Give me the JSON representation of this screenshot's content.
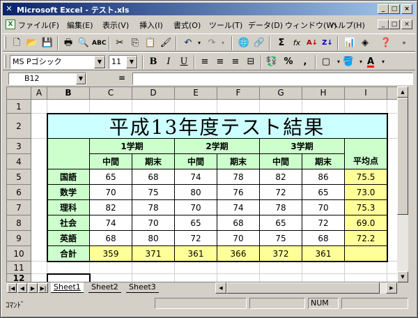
{
  "window": {
    "title": "Microsoft Excel - テスト.xls",
    "app_icon": "excel-icon",
    "controls": {
      "minimize": "_",
      "maximize": "□",
      "close": "×"
    }
  },
  "menu": {
    "items": [
      "ファイル(F)",
      "編集(E)",
      "表示(V)",
      "挿入(I)",
      "書式(O)",
      "ツール(T)",
      "データ(D)",
      "ウィンドウ(W)",
      "ヘルプ(H)"
    ]
  },
  "toolbar_standard": {
    "icons": [
      "new-icon",
      "open-icon",
      "save-icon",
      "print-icon",
      "print-preview-icon",
      "spellcheck-icon",
      "cut-icon",
      "copy-icon",
      "paste-icon",
      "format-painter-icon",
      "undo-icon",
      "redo-icon",
      "hyperlink-icon",
      "web-icon",
      "autosum-icon",
      "function-icon",
      "sort-asc-icon",
      "sort-desc-icon",
      "chart-wizard-icon",
      "drawing-icon",
      "help-icon"
    ],
    "glyphs": {
      "autosum": "Σ",
      "function": "fx"
    }
  },
  "toolbar_format": {
    "font": "MS Pゴシック",
    "size": "11",
    "bold": "B",
    "italic": "I",
    "underline": "U",
    "percent": "%",
    "comma": ",",
    "font_color": "A"
  },
  "formula_bar": {
    "name_box": "B12",
    "eq": "=",
    "value": ""
  },
  "grid": {
    "columns": [
      "A",
      "B",
      "C",
      "D",
      "E",
      "F",
      "G",
      "H",
      "I"
    ],
    "rows": [
      "1",
      "2",
      "3",
      "4",
      "5",
      "6",
      "7",
      "8",
      "9",
      "10",
      "11",
      "12"
    ],
    "active_column": "B",
    "active_row": "12"
  },
  "report": {
    "title": "平成13年度テスト結果",
    "terms": [
      "1学期",
      "2学期",
      "3学期"
    ],
    "sub_headers": [
      "中間",
      "期末",
      "中間",
      "期末",
      "中間",
      "期末"
    ],
    "avg_header": "平均点",
    "subjects": [
      {
        "name": "国語",
        "scores": [
          "65",
          "68",
          "74",
          "78",
          "82",
          "86"
        ],
        "avg": "75.5"
      },
      {
        "name": "数学",
        "scores": [
          "70",
          "75",
          "80",
          "76",
          "72",
          "65"
        ],
        "avg": "73.0"
      },
      {
        "name": "理科",
        "scores": [
          "82",
          "78",
          "70",
          "74",
          "78",
          "70"
        ],
        "avg": "75.3"
      },
      {
        "name": "社会",
        "scores": [
          "74",
          "70",
          "65",
          "68",
          "65",
          "72"
        ],
        "avg": "69.0"
      },
      {
        "name": "英語",
        "scores": [
          "68",
          "80",
          "72",
          "70",
          "75",
          "68"
        ],
        "avg": "72.2"
      }
    ],
    "total_label": "合計",
    "totals": [
      "359",
      "371",
      "361",
      "366",
      "372",
      "361"
    ],
    "colors": {
      "title_bg": "#ccffff",
      "header_bg": "#ccffcc",
      "highlight_bg": "#ffff99"
    }
  },
  "sheets": [
    "Sheet1",
    "Sheet2",
    "Sheet3"
  ],
  "active_sheet": "Sheet1",
  "status": {
    "mode": "ｺﾏﾝﾄﾞ",
    "num": "NUM"
  }
}
